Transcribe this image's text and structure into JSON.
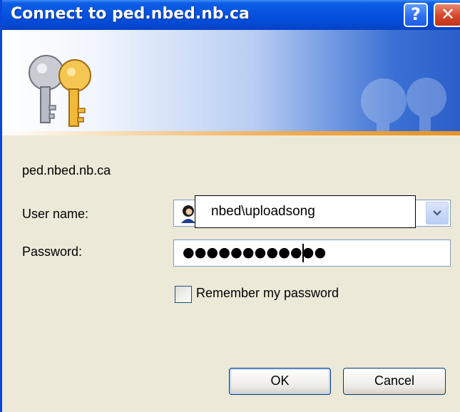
{
  "window": {
    "title": "Connect to ped.nbed.nb.ca",
    "help_label": "?",
    "close_label": "✕"
  },
  "dialog": {
    "server_name": "ped.nbed.nb.ca",
    "username_label": "User name:",
    "username_value": "nbed\\uploadsong",
    "password_label": "Password:",
    "password_dots": "●●●●●●●●●●●●",
    "remember_label": "Remember my password",
    "remember_checked": false,
    "ok_label": "OK",
    "cancel_label": "Cancel"
  },
  "icons": {
    "banner": "keys-icon",
    "watermark": "keys-watermark-icon",
    "user": "user-icon",
    "dropdown": "chevron-down-icon"
  },
  "colors": {
    "titlebar": "#0552e0",
    "dialog_bg": "#ece9d8",
    "close": "#d6462a",
    "accent_stripe": "#f0a84a"
  }
}
